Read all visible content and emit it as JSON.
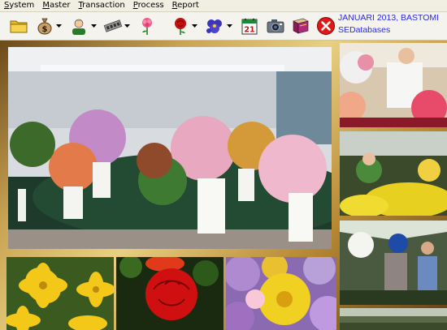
{
  "menu": {
    "items": [
      {
        "label": "System",
        "accel": "S",
        "rest": "ystem"
      },
      {
        "label": "Master",
        "accel": "M",
        "rest": "aster"
      },
      {
        "label": "Transaction",
        "accel": "T",
        "rest": "ransaction"
      },
      {
        "label": "Process",
        "accel": "P",
        "rest": "rocess"
      },
      {
        "label": "Report",
        "accel": "R",
        "rest": "eport"
      }
    ]
  },
  "toolbar": {
    "icons": [
      "folder-icon",
      "money-bag-icon",
      "user-icon",
      "memory-chip-icon",
      "pink-flower-icon",
      "red-rose-icon",
      "pansy-flower-icon",
      "calendar-icon",
      "camera-icon",
      "book-icon",
      "close-icon"
    ],
    "calendar_day": "21"
  },
  "status": {
    "line1": "JANUARI 2013, BASTOMI",
    "line2": "SEDatabases"
  },
  "colors": {
    "status_text": "#2a2ae8",
    "close_red": "#e01818",
    "background_gold": "#c8a352"
  }
}
